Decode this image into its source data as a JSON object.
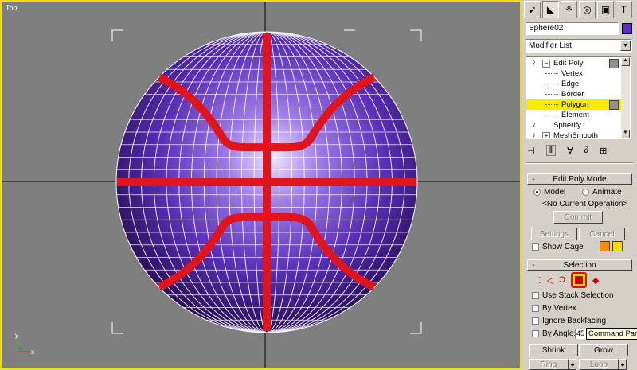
{
  "viewport": {
    "label": "Top",
    "axis_x": "x",
    "axis_y": "y",
    "axis_z": "z",
    "colors": {
      "background": "#7f7f7f",
      "border": "#f0e000",
      "sphere": "#6a3ccc",
      "seams": "#e0141c",
      "wire": "#ffffff"
    }
  },
  "command_panel": {
    "tab_icons": [
      "create-icon",
      "modify-icon",
      "hierarchy-icon",
      "motion-icon",
      "display-icon",
      "utilities-icon"
    ],
    "object_name": "Sphere02",
    "object_color": "#5a2fc0",
    "modifier_list_label": "Modifier List",
    "stack": [
      {
        "label": "Edit Poly",
        "type": "modifier"
      },
      {
        "label": "Vertex",
        "type": "sub"
      },
      {
        "label": "Edge",
        "type": "sub"
      },
      {
        "label": "Border",
        "type": "sub"
      },
      {
        "label": "Polygon",
        "type": "sub",
        "selected": true
      },
      {
        "label": "Element",
        "type": "sub"
      },
      {
        "label": "Spherify",
        "type": "modifier"
      },
      {
        "label": "MeshSmooth",
        "type": "modifier"
      }
    ],
    "edit_poly_mode": {
      "title": "Edit Poly Mode",
      "sign": "-",
      "model_label": "Model",
      "animate_label": "Animate",
      "current_op": "<No Current Operation>",
      "commit_label": "Commit",
      "settings_label": "Settings",
      "cancel_label": "Cancel",
      "show_cage_label": "Show Cage",
      "cage_colors": [
        "#ff8c00",
        "#ffd800"
      ]
    },
    "selection": {
      "title": "Selection",
      "sign": "-",
      "use_stack_label": "Use Stack Selection",
      "by_vertex_label": "By Vertex",
      "ignore_backfacing_label": "Ignore Backfacing",
      "by_angle_label": "By Angle:",
      "by_angle_value": "45",
      "shrink_label": "Shrink",
      "grow_label": "Grow",
      "ring_label": "Ring",
      "loop_label": "Loop"
    },
    "tooltip": "Command Panel"
  }
}
